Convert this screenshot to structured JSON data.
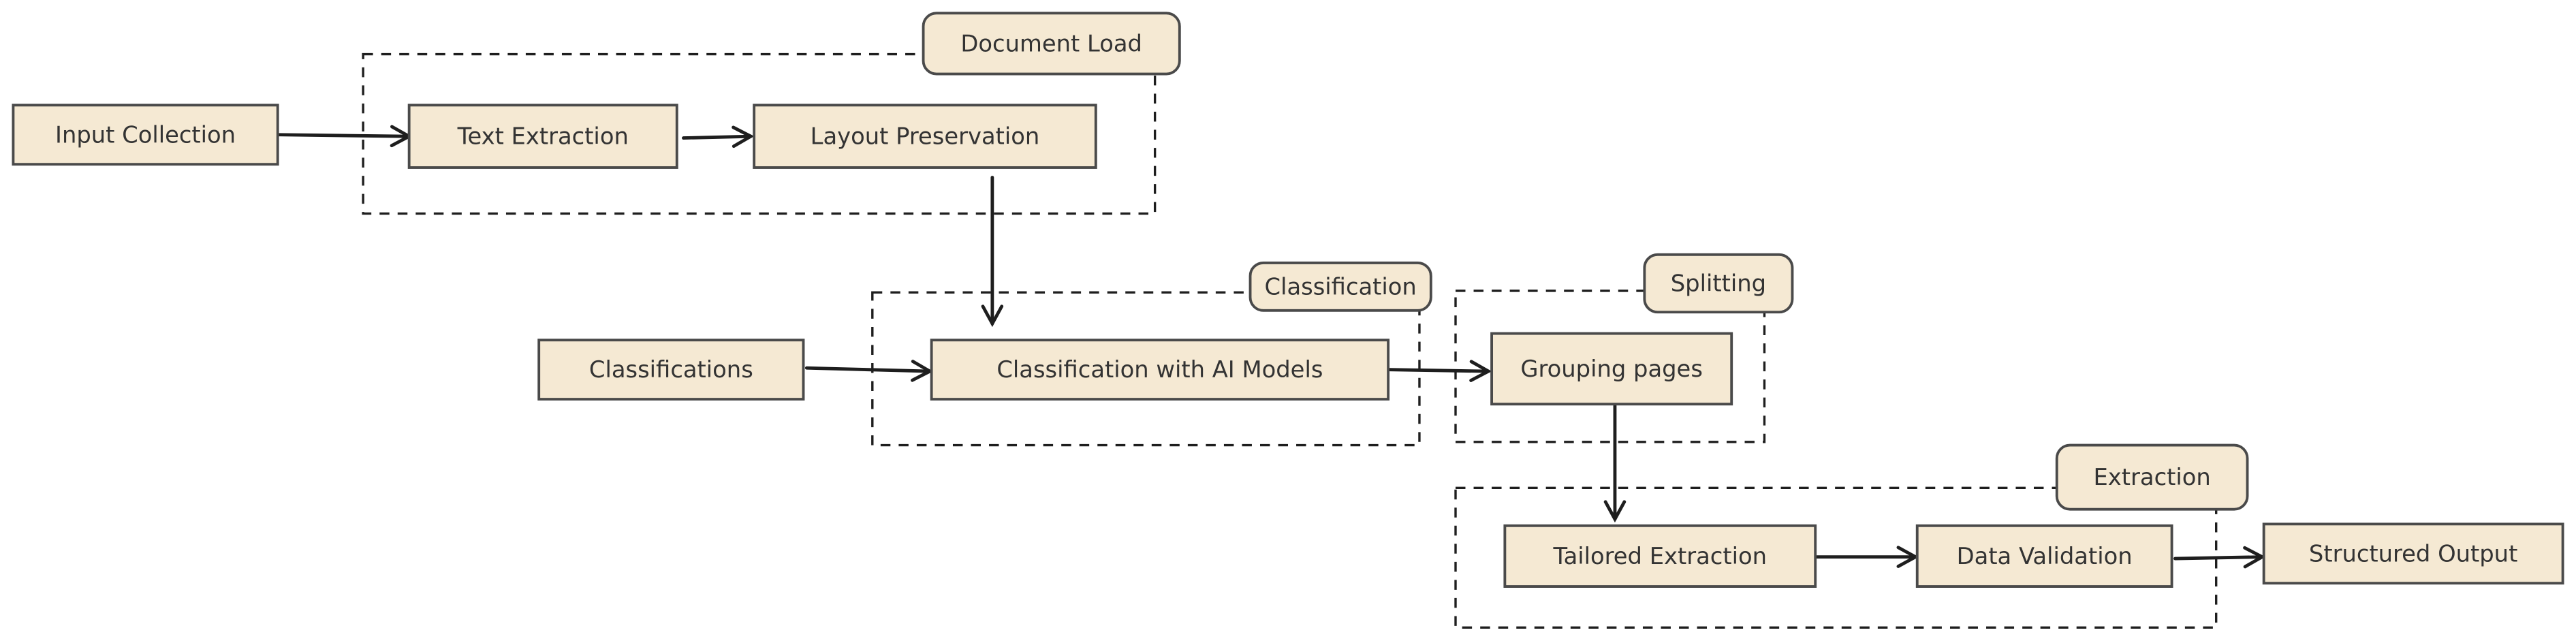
{
  "colors": {
    "node_fill": "#f5e9d3",
    "node_stroke": "#4a4a4a",
    "line": "#1e1e1e",
    "background": "#ffffff"
  },
  "groups": [
    {
      "id": "document-load",
      "label": "Document Load"
    },
    {
      "id": "classification",
      "label": "Classification"
    },
    {
      "id": "splitting",
      "label": "Splitting"
    },
    {
      "id": "extraction",
      "label": "Extraction"
    }
  ],
  "nodes": [
    {
      "id": "input-collection",
      "label": "Input Collection"
    },
    {
      "id": "text-extraction",
      "label": "Text Extraction"
    },
    {
      "id": "layout-preservation",
      "label": "Layout Preservation"
    },
    {
      "id": "classifications",
      "label": "Classifications"
    },
    {
      "id": "classification-ai",
      "label": "Classification with AI Models"
    },
    {
      "id": "grouping-pages",
      "label": "Grouping pages"
    },
    {
      "id": "tailored-extraction",
      "label": "Tailored Extraction"
    },
    {
      "id": "data-validation",
      "label": "Data Validation"
    },
    {
      "id": "structured-output",
      "label": "Structured Output"
    }
  ],
  "edges": [
    {
      "from": "input-collection",
      "to": "text-extraction"
    },
    {
      "from": "text-extraction",
      "to": "layout-preservation"
    },
    {
      "from": "layout-preservation",
      "to": "classification-ai"
    },
    {
      "from": "classifications",
      "to": "classification-ai"
    },
    {
      "from": "classification-ai",
      "to": "grouping-pages"
    },
    {
      "from": "grouping-pages",
      "to": "tailored-extraction"
    },
    {
      "from": "tailored-extraction",
      "to": "data-validation"
    },
    {
      "from": "data-validation",
      "to": "structured-output"
    }
  ]
}
